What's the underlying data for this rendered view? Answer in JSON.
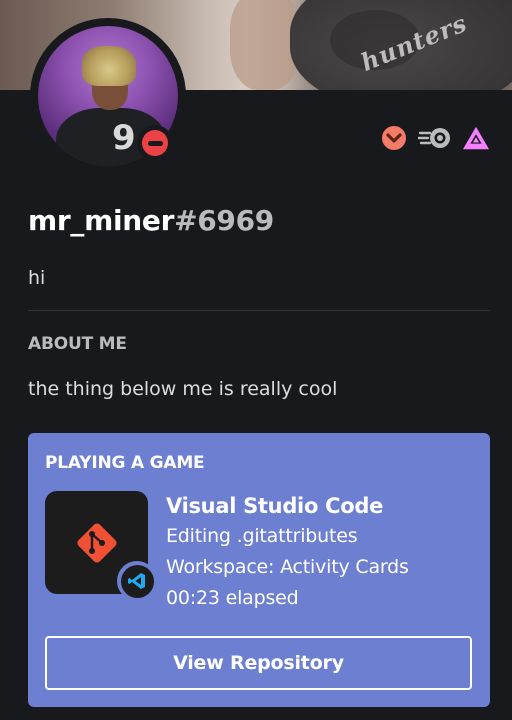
{
  "profile": {
    "banner_text": "hunters",
    "username": "mr_miner",
    "discriminator": "#6969",
    "custom_status": "hi",
    "status": "do-not-disturb",
    "avatar_jersey_number": "9"
  },
  "badges": [
    {
      "icon": "nitro-boost-badge-icon",
      "color": "#f47b67"
    },
    {
      "icon": "nitro-badge-icon",
      "color": "#b9bbbe"
    },
    {
      "icon": "hypesquad-balance-badge-icon",
      "color": "#f47fff"
    }
  ],
  "about": {
    "title": "ABOUT ME",
    "text": "the thing below me is really cool"
  },
  "activity": {
    "heading": "PLAYING A GAME",
    "name": "Visual Studio Code",
    "details": "Editing .gitattributes",
    "state": "Workspace: Activity Cards",
    "elapsed": "00:23 elapsed",
    "large_image_icon": "git-icon",
    "small_image_icon": "vscode-icon",
    "button_label": "View Repository",
    "accent_color": "#6d7fd1"
  },
  "colors": {
    "background": "#18191c",
    "dnd": "#ed4245",
    "git": "#f05033",
    "vscode": "#23a9f2"
  }
}
